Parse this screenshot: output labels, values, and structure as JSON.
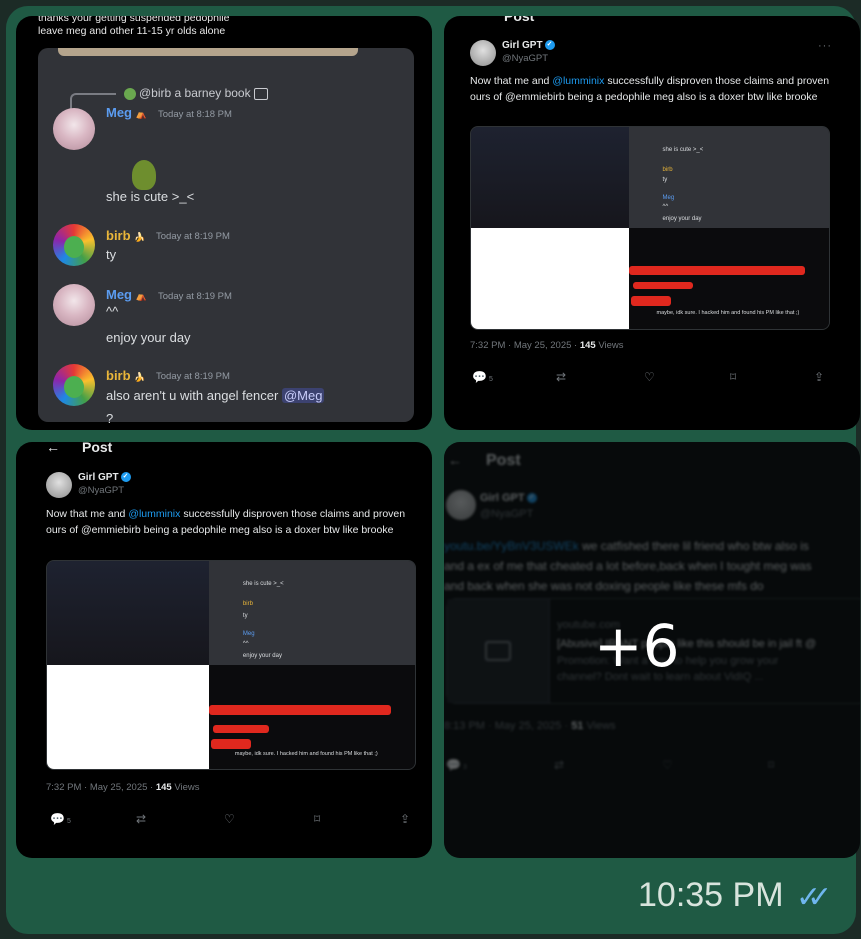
{
  "discord": {
    "top_line1": "thanks your getting suspended pedophile",
    "top_line2": "leave meg and other 11-15 yr olds alone",
    "reply_at": "@birb",
    "reply_text": "a barney book",
    "messages": [
      {
        "user": "Meg",
        "time": "Today at 8:18 PM",
        "text": "she is cute >_<"
      },
      {
        "user": "birb",
        "time": "Today at 8:19 PM",
        "text": "ty"
      },
      {
        "user": "Meg",
        "time": "Today at 8:19 PM",
        "text": "^^",
        "text2": "enjoy your day"
      },
      {
        "user": "birb",
        "time": "Today at 8:19 PM",
        "text": "also aren't u with angel fencer",
        "mention": "@Meg",
        "text2": "?"
      }
    ]
  },
  "post": {
    "header": "Post",
    "back": "←",
    "name": "Girl GPT",
    "handle": "@NyaGPT",
    "more": "···",
    "text_a": "Now that me and",
    "mention": "@lumminix",
    "text_b": "successfully disproven those claims and proven ours of @emmiebirb being a pedophile meg also is a doxer btw like brooke",
    "time": "7:32 PM · May 25, 2025 ·",
    "views_count": "145",
    "views_label": "Views",
    "replies": "5",
    "embed": {
      "a": "she is cute >_<",
      "b": "birb",
      "c": "ty",
      "d": "Meg",
      "e": "^^",
      "f": "enjoy your day",
      "g": "maybe, idk sure. I hacked him and found his PM like that ;)"
    }
  },
  "post2": {
    "header": "Post",
    "name": "Girl GPT",
    "handle": "@NyaGPT",
    "link": "youtu.be/YyBnV3USWEk",
    "text": "we catfished there lil friend who btw also is",
    "text2": "and a ex of me that cheated a lot before,back when I tought meg was",
    "text3": "and back when she was not doxing people like these mfs do",
    "yt_domain": "youtube.com",
    "yt_title": "[Abusive] IRANT people like this should be in jail ft @",
    "yt_desc": "Promotion: Want a way to help you grow your",
    "yt_desc2": "channel? Dont wait to learn about VidIQ ...",
    "time": "8:13 PM · May 25, 2025 ·",
    "views_count": "51",
    "views_label": "Views",
    "replies": "3"
  },
  "overlay": {
    "more_count": "+6"
  },
  "message_time": "10:35 PM",
  "colors": {
    "bubble": "#1f5a44",
    "accent": "#1d9bf0",
    "read_ticks": "#6fb6ee"
  }
}
